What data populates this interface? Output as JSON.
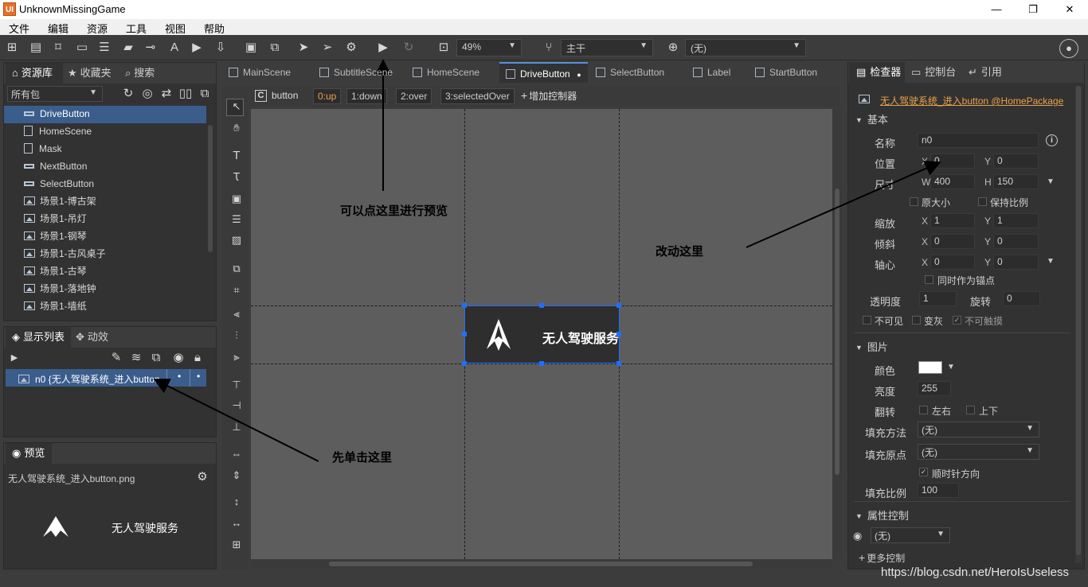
{
  "window": {
    "title": "UnknownMissingGame",
    "logo": "UI"
  },
  "menu": [
    "文件",
    "编辑",
    "资源",
    "工具",
    "视图",
    "帮助"
  ],
  "toolbar": {
    "zoom": "49%",
    "branch": "主干",
    "language": "(无)"
  },
  "assets_panel": {
    "tabs": [
      "资源库",
      "收藏夹",
      "搜索"
    ],
    "filter": "所有包",
    "items": [
      {
        "label": "DriveButton",
        "icon": "button-icon",
        "selected": true
      },
      {
        "label": "HomeScene",
        "icon": "component-icon"
      },
      {
        "label": "Mask",
        "icon": "component-icon"
      },
      {
        "label": "NextButton",
        "icon": "button-icon"
      },
      {
        "label": "SelectButton",
        "icon": "button-icon"
      },
      {
        "label": "场景1-博古架",
        "icon": "image-icon"
      },
      {
        "label": "场景1-吊灯",
        "icon": "image-icon"
      },
      {
        "label": "场景1-钢琴",
        "icon": "image-icon"
      },
      {
        "label": "场景1-古风桌子",
        "icon": "image-icon"
      },
      {
        "label": "场景1-古琴",
        "icon": "image-icon"
      },
      {
        "label": "场景1-落地钟",
        "icon": "image-icon"
      },
      {
        "label": "场景1-墙纸",
        "icon": "image-icon"
      }
    ]
  },
  "display_list": {
    "tabs": [
      "显示列表",
      "动效"
    ],
    "row": "n0 {无人驾驶系统_进入button"
  },
  "preview": {
    "tab": "预览",
    "filename": "无人驾驶系统_进入button.png",
    "button_text": "无人驾驶服务"
  },
  "editor": {
    "tabs": [
      "MainScene",
      "SubtitleScene",
      "HomeScene",
      "DriveButton",
      "SelectButton",
      "Label",
      "StartButton"
    ],
    "active_tab": "DriveButton",
    "controller_name": "button",
    "states": [
      "0:up",
      "1:down",
      "2:over",
      "3:selectedOver"
    ],
    "add_controller": "增加控制器",
    "canvas_button_text": "无人驾驶服务"
  },
  "inspector": {
    "tabs": [
      "检查器",
      "控制台",
      "引用"
    ],
    "resource_link": "无人驾驶系统_进入button @HomePackage",
    "basic": {
      "section": "基本",
      "name_label": "名称",
      "name": "n0",
      "pos_label": "位置",
      "x": "0",
      "y": "0",
      "size_label": "尺寸",
      "w": "400",
      "h": "150",
      "orig_size": "原大小",
      "keep_ratio": "保持比例",
      "scale_label": "缩放",
      "sx": "1",
      "sy": "1",
      "skew_label": "倾斜",
      "kx": "0",
      "ky": "0",
      "pivot_label": "轴心",
      "px": "0",
      "py": "0",
      "anchor": "同时作为锚点",
      "alpha_label": "透明度",
      "alpha": "1",
      "rotation_label": "旋转",
      "rotation": "0",
      "invisible": "不可见",
      "gray": "变灰",
      "untouchable": "不可触摸"
    },
    "image": {
      "section": "图片",
      "color_label": "颜色",
      "color": "#ffffff",
      "brightness_label": "亮度",
      "brightness": "255",
      "flip_label": "翻转",
      "flip_h": "左右",
      "flip_v": "上下",
      "fill_method_label": "填充方法",
      "fill_method": "(无)",
      "fill_origin_label": "填充原点",
      "fill_origin": "(无)",
      "clockwise": "顺时针方向",
      "fill_amount_label": "填充比例",
      "fill_amount": "100"
    },
    "gear": {
      "section": "属性控制",
      "value": "(无)",
      "more": "更多控制"
    }
  },
  "annotations": {
    "preview_hint": "可以点这里进行预览",
    "change_hint": "改动这里",
    "click_hint": "先单击这里"
  },
  "watermark": "https://blog.csdn.net/HeroIsUseless",
  "colors": {
    "accent": "#5a8fd6",
    "selection": "#3b5d8c",
    "handle": "#1f6fff",
    "link": "#e8a24a"
  }
}
